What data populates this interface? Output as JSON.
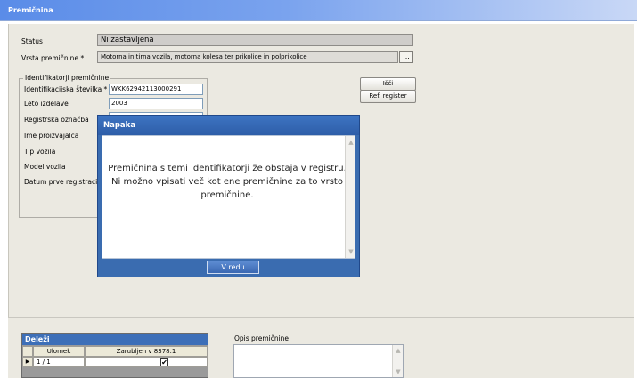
{
  "window": {
    "title": "Premičnina"
  },
  "form": {
    "status_label": "Status",
    "status_value": "Ni zastavljena",
    "type_label": "Vrsta premičnine *",
    "type_value": "Motorna in tirna vozila, motorna kolesa ter prikolice in polprikolice",
    "type_button": "...",
    "identifiers_legend": "Identifikatorji premičnine",
    "fields": [
      {
        "label": "Identifikacijska številka *",
        "value": "WKK62942113000291"
      },
      {
        "label": "Leto izdelave",
        "value": "2003"
      },
      {
        "label": "Registrska označba",
        "value": ""
      },
      {
        "label": "Ime proizvajalca",
        "value": ""
      },
      {
        "label": "Tip vozila",
        "value": ""
      },
      {
        "label": "Model vozila",
        "value": ""
      },
      {
        "label": "Datum prve registracije",
        "value": ""
      }
    ],
    "buttons": {
      "search": "Išči",
      "ref_register": "Ref. register"
    }
  },
  "shares": {
    "title": "Deleži",
    "columns": [
      "Ulomek",
      "Zarubljen v 8378.1"
    ],
    "rows": [
      {
        "fraction": "1 / 1",
        "seized": true
      }
    ]
  },
  "description": {
    "label": "Opis premičnine"
  },
  "dialog": {
    "title": "Napaka",
    "message": "Premičnina s temi identifikatorji že obstaja v registru. Ni možno vpisati več kot ene premičnine za to vrsto premičnine.",
    "ok_label": "V redu"
  },
  "colors": {
    "titlebar": "#5a8ce8",
    "dialog_frame": "#3a6cb0",
    "panel": "#ebe9e1"
  }
}
